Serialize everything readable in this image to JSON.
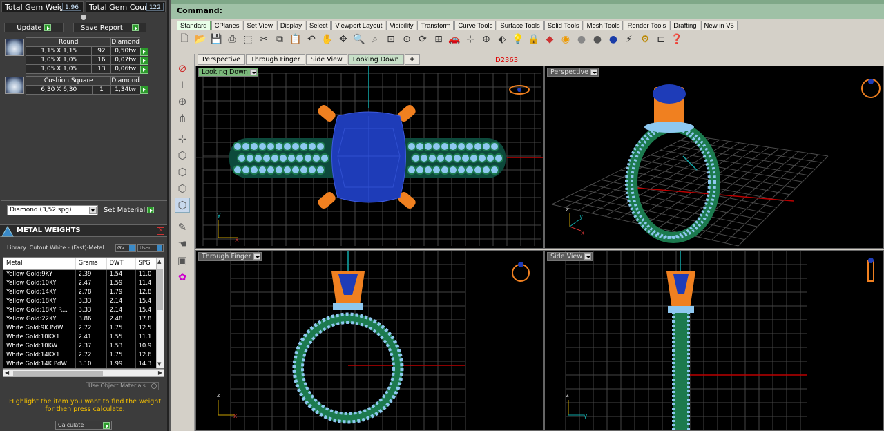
{
  "gem_summary": {
    "weight_label": "Total Gem Weight",
    "weight_value": "1.96",
    "count_label": "Total Gem Count",
    "count_value": "122",
    "update_label": "Update",
    "save_label": "Save Report"
  },
  "gem_groups": [
    {
      "shape": "Round",
      "type": "Diamond",
      "rows": [
        {
          "size": "1,15 X 1,15",
          "qty": "92",
          "tw": "0,50tw"
        },
        {
          "size": "1,05 X 1,05",
          "qty": "16",
          "tw": "0,07tw"
        },
        {
          "size": "1,05 X 1,05",
          "qty": "13",
          "tw": "0,06tw"
        }
      ]
    },
    {
      "shape": "Cushion Square",
      "type": "Diamond",
      "rows": [
        {
          "size": "6,30 X 6,30",
          "qty": "1",
          "tw": "1,34tw"
        }
      ]
    }
  ],
  "material_select": "Diamond    (3,52 spg)",
  "set_material_label": "Set Material",
  "metal_weights": {
    "title": "METAL WEIGHTS",
    "library": "Library: Cutout White - (Fast)-Metal",
    "gv_label": "GV",
    "user_label": "User",
    "columns": [
      "Metal",
      "Grams",
      "DWT",
      "SPG"
    ],
    "rows": [
      [
        "Yellow Gold:9KY",
        "2.39",
        "1.54",
        "11.0"
      ],
      [
        "Yellow Gold:10KY",
        "2.47",
        "1.59",
        "11.4"
      ],
      [
        "Yellow Gold:14KY",
        "2.78",
        "1.79",
        "12.8"
      ],
      [
        "Yellow Gold:18KY",
        "3.33",
        "2.14",
        "15.4"
      ],
      [
        "Yellow Gold:18KY R...",
        "3.33",
        "2.14",
        "15.4"
      ],
      [
        "Yellow Gold:22KY",
        "3.86",
        "2.48",
        "17.8"
      ],
      [
        "White Gold:9K PdW",
        "2.72",
        "1.75",
        "12.5"
      ],
      [
        "White Gold:10KX1",
        "2.41",
        "1.55",
        "11.1"
      ],
      [
        "White Gold:10KW",
        "2.37",
        "1.53",
        "10.9"
      ],
      [
        "White Gold:14KX1",
        "2.72",
        "1.75",
        "12.6"
      ],
      [
        "White Gold:14K PdW",
        "3.10",
        "1.99",
        "14.3"
      ]
    ],
    "use_object_label": "Use Object Materials",
    "hint": "Highlight the item you want to find the weight for then press calculate.",
    "calculate_label": "Calculate"
  },
  "command_label": "Command:",
  "toolbar_tabs": [
    "Standard",
    "CPlanes",
    "Set View",
    "Display",
    "Select",
    "Viewport Layout",
    "Visibility",
    "Transform",
    "Curve Tools",
    "Surface Tools",
    "Solid Tools",
    "Mesh Tools",
    "Render Tools",
    "Drafting",
    "New in V5"
  ],
  "viewport_tabs": [
    "Perspective",
    "Through Finger",
    "Side View",
    "Looking Down"
  ],
  "model_id": "ID2363",
  "viewports": {
    "looking_down": "Looking Down",
    "perspective": "Perspective",
    "through_finger": "Through Finger",
    "side_view": "Side View"
  },
  "axis": {
    "x": "x",
    "y": "y",
    "z": "z"
  },
  "colors": {
    "metal_green": "#1c7a4e",
    "prong_orange": "#f08020",
    "gem_blue": "#1e3cb8",
    "pave_light": "#8ec8f0",
    "grid": "#4a4a4a"
  }
}
